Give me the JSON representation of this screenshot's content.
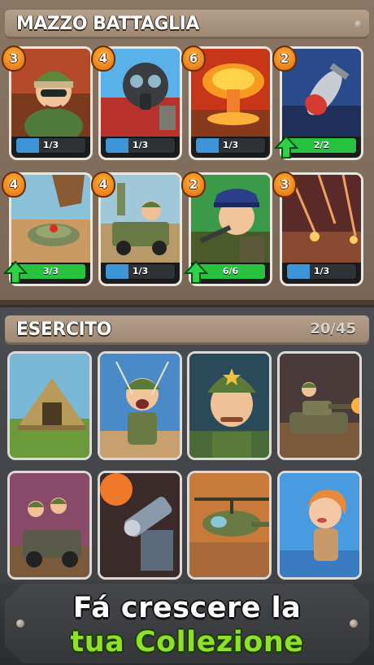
{
  "deck": {
    "title": "MAZZO BATTAGLIA",
    "cards": [
      {
        "name": "soldier-card",
        "cost": "3",
        "progress": "1/3",
        "fill": 0.33,
        "upgradable": false
      },
      {
        "name": "gas-mask-card",
        "cost": "4",
        "progress": "1/3",
        "fill": 0.33,
        "upgradable": false
      },
      {
        "name": "explosion-card",
        "cost": "6",
        "progress": "1/3",
        "fill": 0.33,
        "upgradable": false
      },
      {
        "name": "bomb-card",
        "cost": "2",
        "progress": "2/2",
        "fill": 1.0,
        "upgradable": true
      },
      {
        "name": "landmine-card",
        "cost": "4",
        "progress": "3/3",
        "fill": 1.0,
        "upgradable": true
      },
      {
        "name": "jeep-card",
        "cost": "4",
        "progress": "1/3",
        "fill": 0.33,
        "upgradable": false
      },
      {
        "name": "officer-card",
        "cost": "2",
        "progress": "6/6",
        "fill": 1.0,
        "upgradable": true
      },
      {
        "name": "missile-strike-card",
        "cost": "3",
        "progress": "1/3",
        "fill": 0.33,
        "upgradable": false
      }
    ]
  },
  "army": {
    "title": "ESERCITO",
    "count": "20/45",
    "cards": [
      {
        "name": "tent-card"
      },
      {
        "name": "paratrooper-card"
      },
      {
        "name": "sergeant-card"
      },
      {
        "name": "tank-card"
      },
      {
        "name": "squad-jeep-card"
      },
      {
        "name": "gatling-card"
      },
      {
        "name": "helicopter-card"
      },
      {
        "name": "heroine-card"
      }
    ]
  },
  "banner": {
    "line1": "Fá crescere la",
    "line2": "tua Collezione"
  },
  "colors": {
    "progress_blue": "#3d95d8",
    "progress_green": "#27c240",
    "banner_green": "#8ee02a",
    "cost_orange": "#f08a1c"
  }
}
